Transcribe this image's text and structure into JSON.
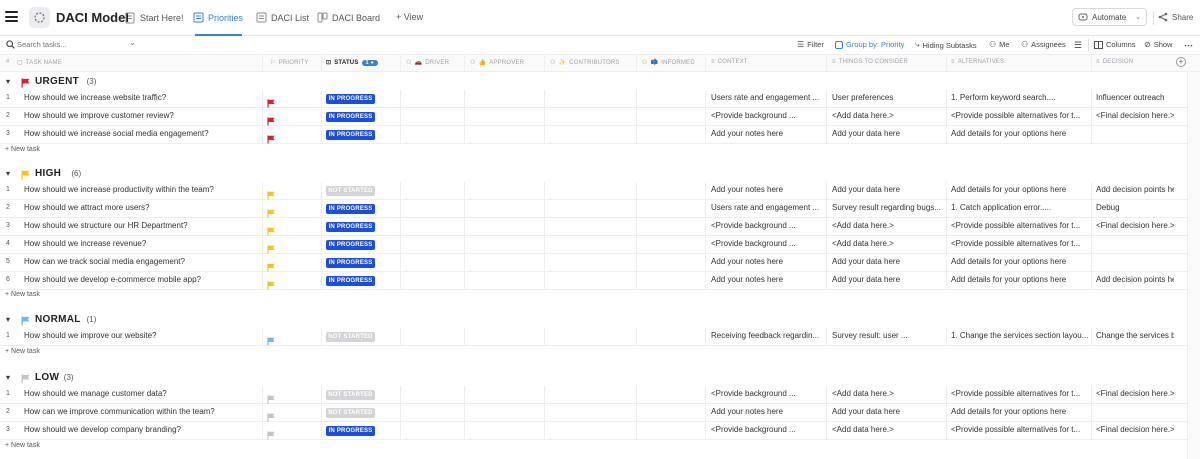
{
  "app": {
    "title": "DACI Model"
  },
  "tabs": [
    {
      "label": "Start Here!",
      "icon": "doc-icon"
    },
    {
      "label": "Priorities",
      "icon": "list-icon",
      "active": true
    },
    {
      "label": "DACI List",
      "icon": "list-icon"
    },
    {
      "label": "DACI Board",
      "icon": "board-icon"
    }
  ],
  "add_view": "+ View",
  "automate": "Automate",
  "share": "Share",
  "search": {
    "placeholder": "Search tasks..."
  },
  "toolbar": {
    "filter": "Filter",
    "group_by": "Group by: Priority",
    "subtasks": "Hiding Subtasks",
    "me": "Me",
    "assignees": "Assignees",
    "columns": "Columns",
    "show": "Show"
  },
  "columns": {
    "num": "#",
    "task_name": "TASK NAME",
    "priority": "PRIORITY",
    "status": "STATUS",
    "status_badge": "1 ●",
    "driver": "DRIVER",
    "approver": "APPROVER",
    "contributors": "CONTRIBUTORS",
    "informed": "INFORMED",
    "context": "CONTEXT",
    "things": "THINGS TO CONSIDER",
    "alternatives": "ALTERNATIVES",
    "decision": "DECISION"
  },
  "colors": {
    "urgent": "#e11d2c",
    "high": "#f5c518",
    "normal": "#6fb7e6",
    "low": "#c4c4c8",
    "in_progress": "#1d4ed8",
    "not_started": "#d4d4d8",
    "accent": "#3b82c4"
  },
  "new_task_label": "+ New task",
  "groups": [
    {
      "name": "URGENT",
      "count": "(3)",
      "flag": "urgent",
      "tasks": [
        {
          "num": "1",
          "name": "How should we increase website traffic?",
          "status": "IN PROGRESS",
          "context": "Users rate and engagement ...",
          "things": "User preferences",
          "alternatives": "1. Perform keyword search....",
          "decision": "Influencer outreach"
        },
        {
          "num": "2",
          "name": "How should we improve customer review?",
          "status": "IN PROGRESS",
          "context": "<Provide background ...",
          "things": "<Add data here.>",
          "alternatives": "<Provide possible alternatives for t...",
          "decision": "<Final decision here.>"
        },
        {
          "num": "3",
          "name": "How should we increase social media engagement?",
          "status": "IN PROGRESS",
          "context": "Add your notes here",
          "things": "Add your data here",
          "alternatives": "Add details for your options here",
          "decision": ""
        }
      ]
    },
    {
      "name": "HIGH",
      "count": "(6)",
      "flag": "high",
      "tasks": [
        {
          "num": "1",
          "name": "How should we increase productivity within the team?",
          "status": "NOT STARTED",
          "context": "Add your notes here",
          "things": "Add your data here",
          "alternatives": "Add details for your options here",
          "decision": "Add decision points here"
        },
        {
          "num": "2",
          "name": "How should we attract more users?",
          "status": "IN PROGRESS",
          "context": "Users rate and engagement ...",
          "things": "Survey result regarding bugs...",
          "alternatives": "1. Catch application error.....",
          "decision": "Debug"
        },
        {
          "num": "3",
          "name": "How should we structure our HR Department?",
          "status": "IN PROGRESS",
          "context": "<Provide background ...",
          "things": "<Add data here.>",
          "alternatives": "<Provide possible alternatives for t...",
          "decision": "<Final decision here.>"
        },
        {
          "num": "4",
          "name": "How should we increase revenue?",
          "status": "IN PROGRESS",
          "context": "<Provide background ...",
          "things": "<Add data here.>",
          "alternatives": "<Provide possible alternatives for t...",
          "decision": ""
        },
        {
          "num": "5",
          "name": "How can we track social media engagement?",
          "status": "IN PROGRESS",
          "context": "Add your notes here",
          "things": "Add your data here",
          "alternatives": "Add details for your options here",
          "decision": ""
        },
        {
          "num": "6",
          "name": "How should we develop e-commerce mobile app?",
          "status": "IN PROGRESS",
          "context": "Add your notes here",
          "things": "Add your data here",
          "alternatives": "Add details for your options here",
          "decision": "Add decision points here"
        }
      ]
    },
    {
      "name": "NORMAL",
      "count": "(1)",
      "flag": "normal",
      "tasks": [
        {
          "num": "1",
          "name": "How should we improve our website?",
          "status": "NOT STARTED",
          "context": "Receiving feedback regardin...",
          "things": "Survey result: user ...",
          "alternatives": "1. Change the services section layou...",
          "decision": "Change the services block"
        }
      ]
    },
    {
      "name": "LOW",
      "count": "(3)",
      "flag": "low",
      "tasks": [
        {
          "num": "1",
          "name": "How should we manage customer data?",
          "status": "NOT STARTED",
          "context": "<Provide background ...",
          "things": "<Add data here.>",
          "alternatives": "<Provide possible alternatives for t...",
          "decision": "<Final decision here.>"
        },
        {
          "num": "2",
          "name": "How can we improve communication within the team?",
          "status": "NOT STARTED",
          "context": "Add your notes here",
          "things": "Add your data here",
          "alternatives": "Add details for your options here",
          "decision": ""
        },
        {
          "num": "3",
          "name": "How should we develop company branding?",
          "status": "IN PROGRESS",
          "context": "<Provide background ...",
          "things": "<Add data here.>",
          "alternatives": "<Provide possible alternatives for t...",
          "decision": "<Final decision here.>"
        }
      ]
    }
  ]
}
